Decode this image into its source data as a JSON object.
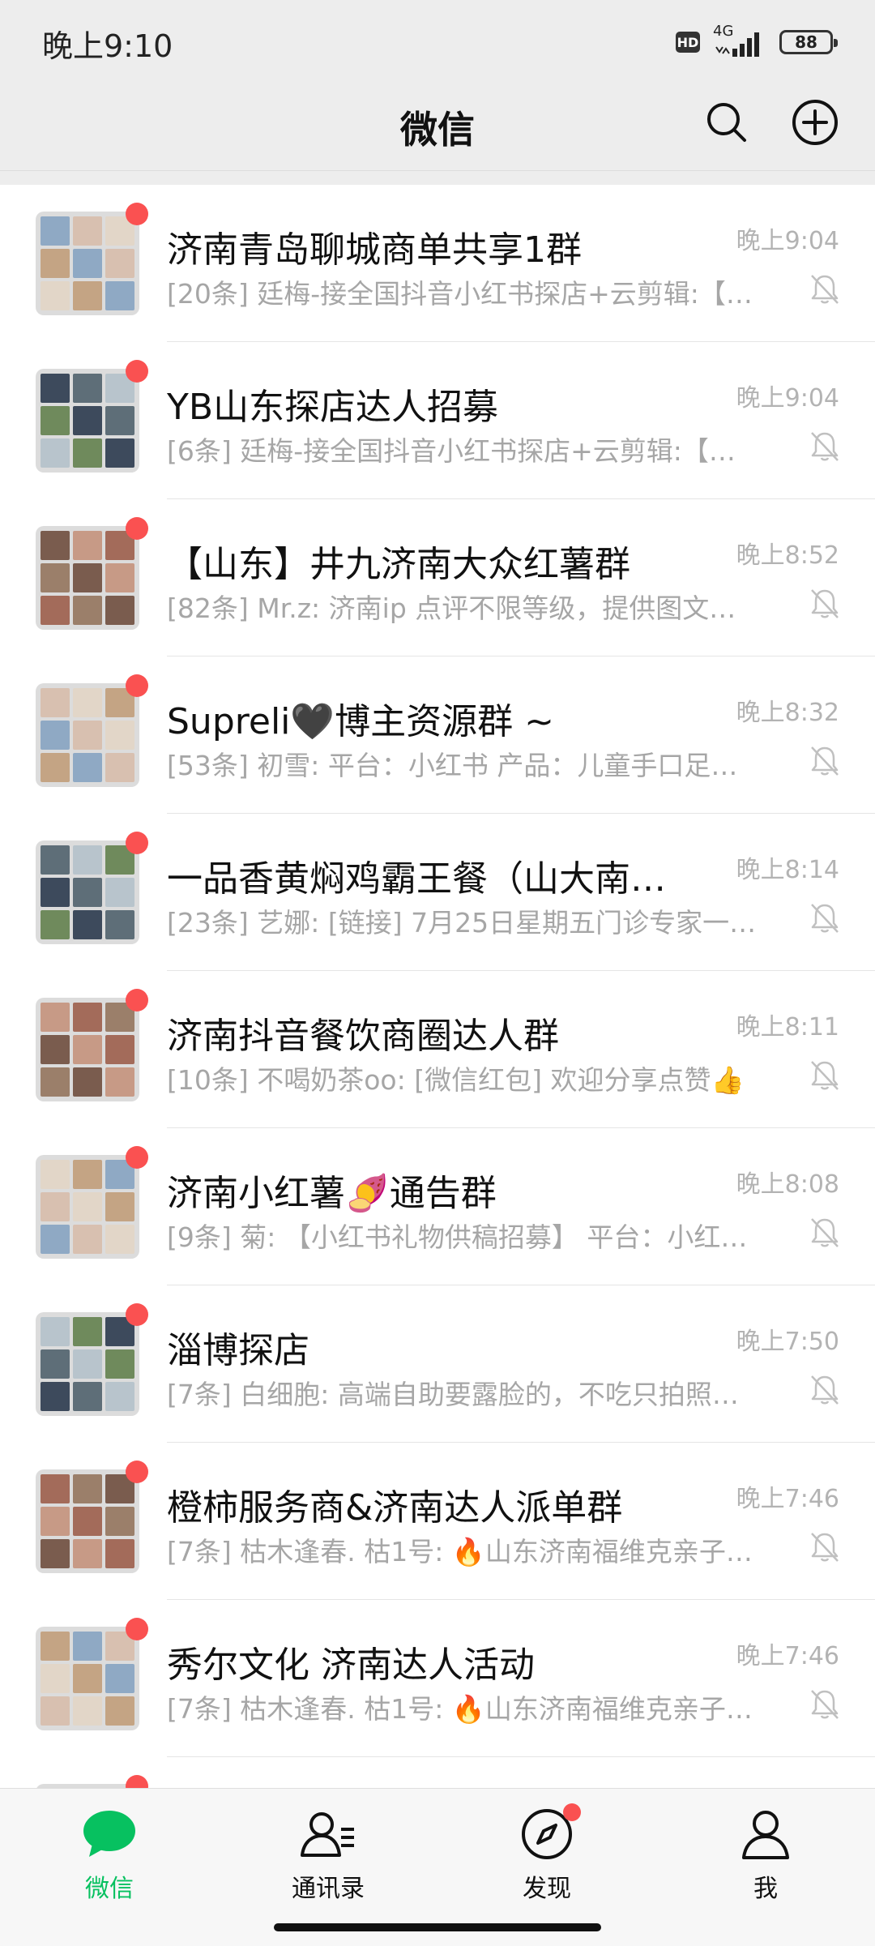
{
  "status_bar": {
    "time": "晚上9:10",
    "hd": "HD",
    "network": "4G",
    "battery": "88"
  },
  "header": {
    "title": "微信"
  },
  "colors": {
    "accent": "#07c160",
    "badge": "#fa5151",
    "muted": "#a6a6a6"
  },
  "chats": [
    {
      "name": "济南青岛聊城商单共享1群",
      "time": "晚上9:04",
      "preview": "[20条] 廷梅-接全国抖音小红书探店+云剪辑:【…",
      "muted": true,
      "unread": true
    },
    {
      "name": "YB山东探店达人招募",
      "time": "晚上9:04",
      "preview": "[6条] 廷梅-接全国抖音小红书探店+云剪辑:【…",
      "muted": true,
      "unread": true
    },
    {
      "name": "【山东】井九济南大众红薯群",
      "time": "晚上8:52",
      "preview": "[82条] Mr.z: 济南ip 点评不限等级，提供图文…",
      "muted": true,
      "unread": true
    },
    {
      "name": "Supreli🖤博主资源群 ~",
      "time": "晚上8:32",
      "preview": "[53条] 初雪: 平台：小红书 产品：儿童手口足…",
      "muted": true,
      "unread": true
    },
    {
      "name": "一品香黄焖鸡霸王餐（山大南…",
      "time": "晚上8:14",
      "preview": "[23条] 艺娜: [链接] 7月25日星期五门诊专家一…",
      "muted": true,
      "unread": true
    },
    {
      "name": "济南抖音餐饮商圈达人群",
      "time": "晚上8:11",
      "preview": "[10条] 不喝奶茶oo: [微信红包] 欢迎分享点赞👍",
      "muted": true,
      "unread": true
    },
    {
      "name": "济南小红薯🍠通告群",
      "time": "晚上8:08",
      "preview": "[9条] 菊: 【小红书礼物供稿招募】 平台：小红…",
      "muted": true,
      "unread": true
    },
    {
      "name": "淄博探店",
      "time": "晚上7:50",
      "preview": "[7条] 白细胞: 高端自助要露脸的，不吃只拍照…",
      "muted": true,
      "unread": true
    },
    {
      "name": "橙柿服务商&济南达人派单群",
      "time": "晚上7:46",
      "preview": "[7条] 枯木逢春. 枯1号: 🔥山东济南福维克亲子…",
      "muted": true,
      "unread": true
    },
    {
      "name": "秀尔文化 济南达人活动",
      "time": "晚上7:46",
      "preview": "[7条] 枯木逢春. 枯1号: 🔥山东济南福维克亲子…",
      "muted": true,
      "unread": true
    },
    {
      "name": "",
      "time": "",
      "preview": "",
      "muted": false,
      "unread": true
    }
  ],
  "tabbar": {
    "chats": "微信",
    "contacts": "通讯录",
    "discover": "发现",
    "me": "我"
  }
}
